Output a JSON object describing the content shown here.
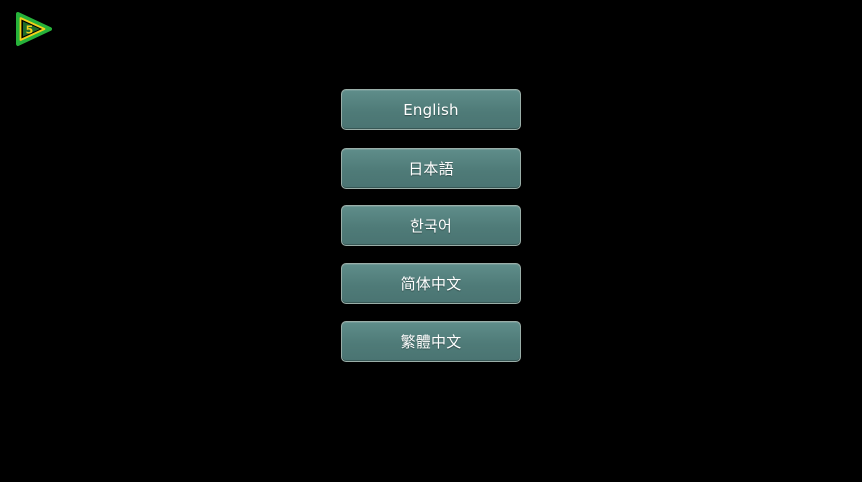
{
  "languages": [
    {
      "label": "English"
    },
    {
      "label": "日本語"
    },
    {
      "label": "한국어"
    },
    {
      "label": "简体中文"
    },
    {
      "label": "繁體中文"
    }
  ],
  "colors": {
    "background": "#000000",
    "button_fill": "#5a8785",
    "button_border": "#9aaea8",
    "button_text": "#ffffff",
    "logo_green": "#27b23a",
    "logo_yellow": "#f2d21a"
  },
  "logo": {
    "icon": "play-triangle-logo-icon",
    "glyph": "5"
  }
}
